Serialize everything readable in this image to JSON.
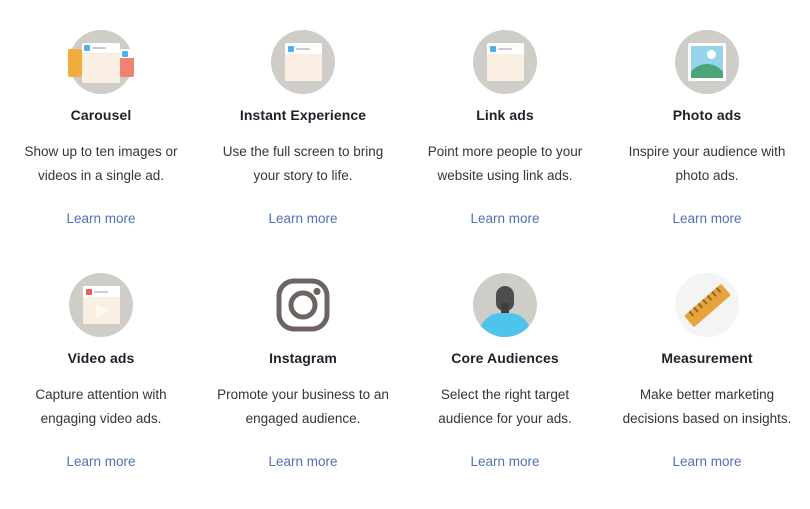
{
  "grid": {
    "rows": [
      {
        "cards": [
          {
            "icon": "carousel-icon",
            "title": "Carousel",
            "desc": "Show up to ten images or videos in a single ad.",
            "link": "Learn more"
          },
          {
            "icon": "instant-experience-icon",
            "title": "Instant Experience",
            "desc": "Use the full screen to bring your story to life.",
            "link": "Learn more"
          },
          {
            "icon": "link-ads-icon",
            "title": "Link ads",
            "desc": "Point more people to your website using link ads.",
            "link": "Learn more"
          },
          {
            "icon": "photo-ads-icon",
            "title": "Photo ads",
            "desc": "Inspire your audience with photo ads.",
            "link": "Learn more"
          }
        ]
      },
      {
        "cards": [
          {
            "icon": "video-ads-icon",
            "title": "Video ads",
            "desc": "Capture attention with engaging video ads.",
            "link": "Learn more"
          },
          {
            "icon": "instagram-icon",
            "title": "Instagram",
            "desc": "Promote your business to an engaged audience.",
            "link": "Learn more"
          },
          {
            "icon": "core-audiences-icon",
            "title": "Core Audiences",
            "desc": "Select the right target audience for your ads.",
            "link": "Learn more"
          },
          {
            "icon": "measurement-icon",
            "title": "Measurement",
            "desc": "Make better marketing decisions based on insights.",
            "link": "Learn more"
          }
        ]
      }
    ]
  },
  "colors": {
    "link": "#4f71b8",
    "title": "#1d2129",
    "body_text": "#30363c",
    "icon_circle": "#cfcdc8",
    "icon_circle_pale": "#f4f4f4",
    "carousel_orange": "#f2ac3e",
    "carousel_red": "#f08271",
    "card_body_cream": "#fbeee2",
    "accent_blue": "#4ab3e8",
    "accent_red": "#ea5f4f",
    "photo_sky": "#95d4ec",
    "photo_hill": "#4aa579",
    "shirt_cyan": "#4ec3ec",
    "silhouette": "#4d4d4d",
    "instagram_gray": "#6d6461",
    "ruler_orange": "#e8a33d"
  }
}
